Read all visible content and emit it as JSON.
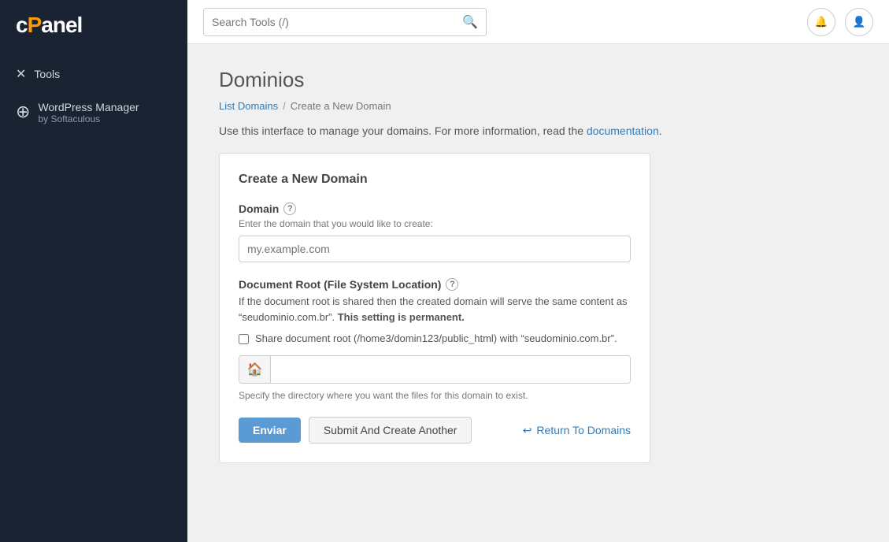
{
  "sidebar": {
    "logo_text": "cPanel",
    "items": [
      {
        "id": "tools",
        "label": "Tools",
        "icon": "✕"
      },
      {
        "id": "wordpress",
        "label": "WordPress Manager",
        "sub": "by Softaculous",
        "icon": "W"
      }
    ]
  },
  "header": {
    "search_placeholder": "Search Tools (/)",
    "search_label": "Search Tools (/)"
  },
  "page": {
    "title": "Dominios",
    "breadcrumb_link": "List Domains",
    "breadcrumb_sep": "/",
    "breadcrumb_current": "Create a New Domain",
    "description_text": "Use this interface to manage your domains. For more information, read the",
    "description_link": "documentation",
    "description_end": "."
  },
  "form": {
    "card_title": "Create a New Domain",
    "domain_label": "Domain",
    "domain_help": "Enter the domain that you would like to create:",
    "domain_placeholder": "my.example.com",
    "doc_root_label": "Document Root (File System Location)",
    "doc_root_desc1": "If the document root is shared then the created domain will serve the same content as “seudominio.com.br”.",
    "doc_root_desc2": "This setting is permanent.",
    "checkbox_label": "Share document root (/home3/domin123/public_html) with “seudominio.com.br”.",
    "dir_hint": "Specify the directory where you want the files for this domain to exist.",
    "btn_submit": "Enviar",
    "btn_create_another": "Submit And Create Another",
    "btn_return": "Return To Domains"
  }
}
